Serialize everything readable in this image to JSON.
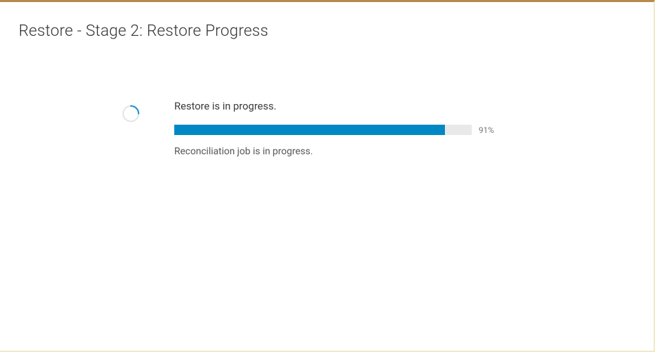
{
  "header": {
    "title": "Restore - Stage 2: Restore Progress"
  },
  "progress": {
    "status_text": "Restore is in progress.",
    "percent_value": 91,
    "percent_label": "91%",
    "sub_status": "Reconciliation job is in progress."
  },
  "colors": {
    "accent": "#0088c4",
    "spinner": "#1c93d0"
  }
}
